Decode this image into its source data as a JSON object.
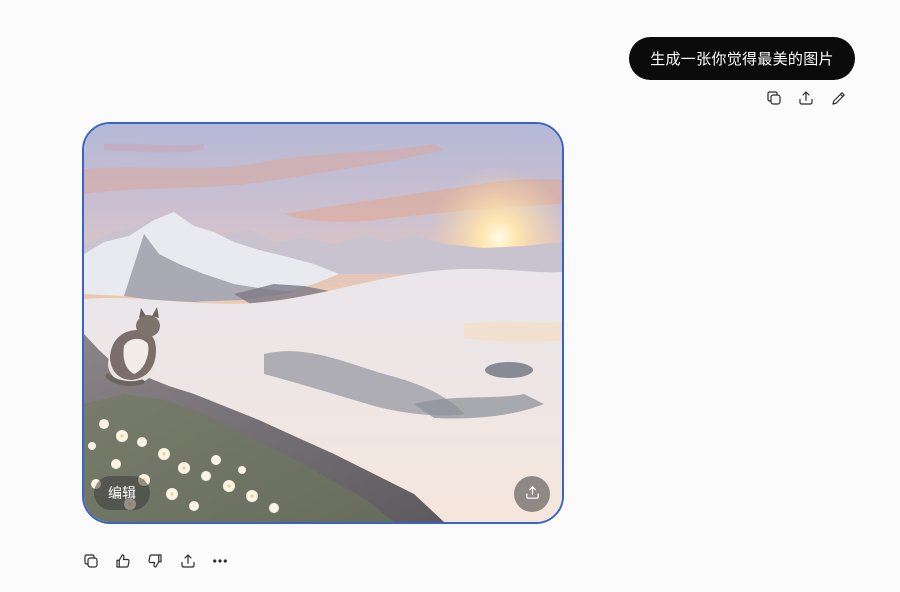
{
  "user_message": {
    "text": "生成一张你觉得最美的图片"
  },
  "user_actions": {
    "icons": [
      "copy-icon",
      "share-icon",
      "edit-icon"
    ]
  },
  "generated_image": {
    "edit_label": "编辑",
    "share_icon": "share-icon"
  },
  "response_actions": {
    "icons": [
      "copy-icon",
      "thumbs-up-icon",
      "thumbs-down-icon",
      "share-icon",
      "more-icon"
    ]
  },
  "colors": {
    "page_bg": "#fbfbfb",
    "bubble_bg": "#0b0b0b",
    "bubble_text": "#ffffff",
    "image_border": "#3a63c9",
    "icon_stroke": "#2c2c2c"
  }
}
